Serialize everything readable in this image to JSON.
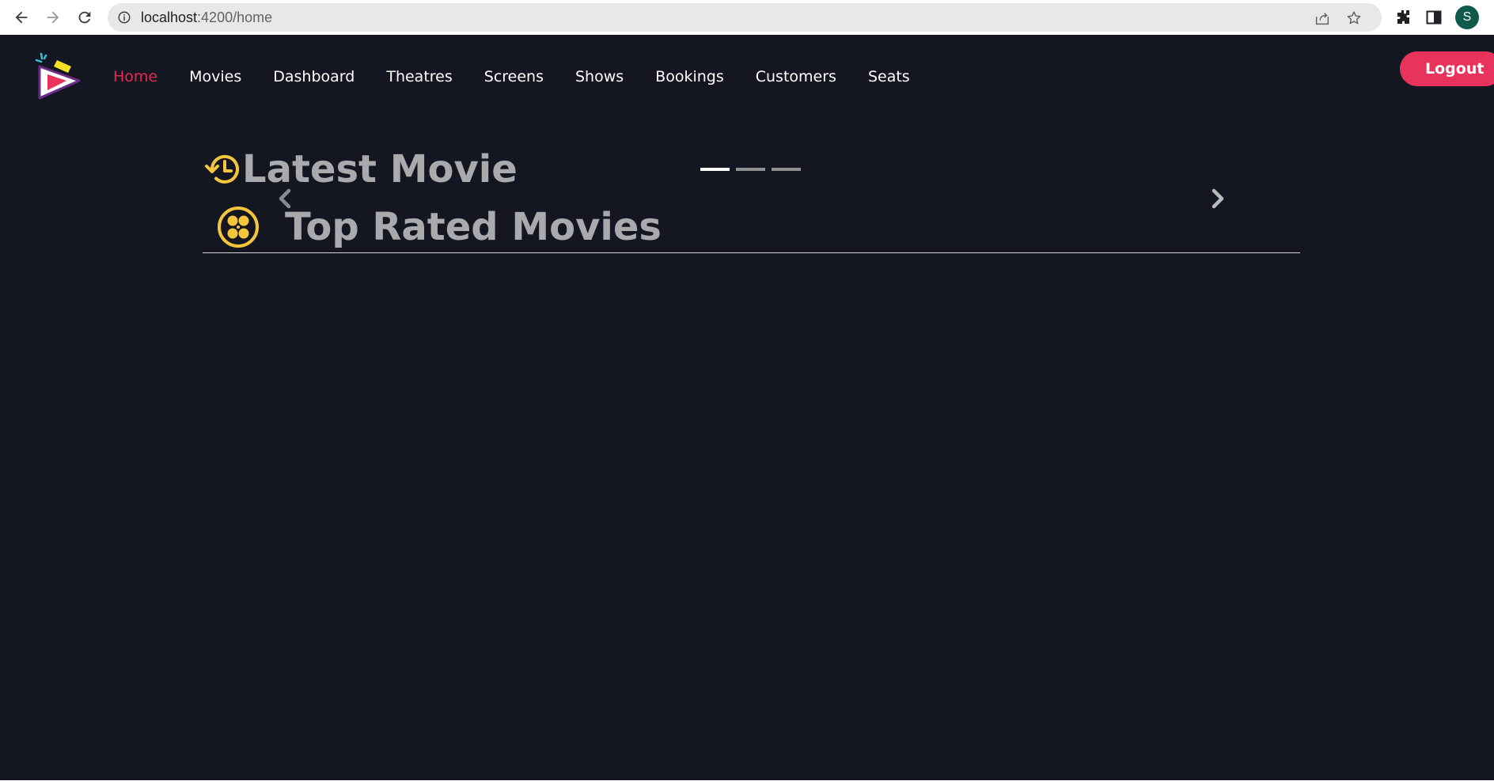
{
  "browser": {
    "url_host": "localhost",
    "url_path": ":4200/home",
    "profile_initial": "S"
  },
  "nav": {
    "items": [
      {
        "label": "Home",
        "active": true
      },
      {
        "label": "Movies",
        "active": false
      },
      {
        "label": "Dashboard",
        "active": false
      },
      {
        "label": "Theatres",
        "active": false
      },
      {
        "label": "Screens",
        "active": false
      },
      {
        "label": "Shows",
        "active": false
      },
      {
        "label": "Bookings",
        "active": false
      },
      {
        "label": "Customers",
        "active": false
      },
      {
        "label": "Seats",
        "active": false
      }
    ],
    "logout_label": "Logout"
  },
  "sections": {
    "latest_title": "Latest Movie",
    "latest_icon": "history-clock-icon",
    "top_rated_title": "Top Rated Movies",
    "top_rated_icon": "film-reel-icon"
  },
  "carousel": {
    "slide_count": 3,
    "active_index": 0
  },
  "colors": {
    "background": "#141721",
    "accent": "#e8345c",
    "active_nav": "#e8274f",
    "heading": "#a9a9ae",
    "icon_yellow": "#f4c63d"
  }
}
